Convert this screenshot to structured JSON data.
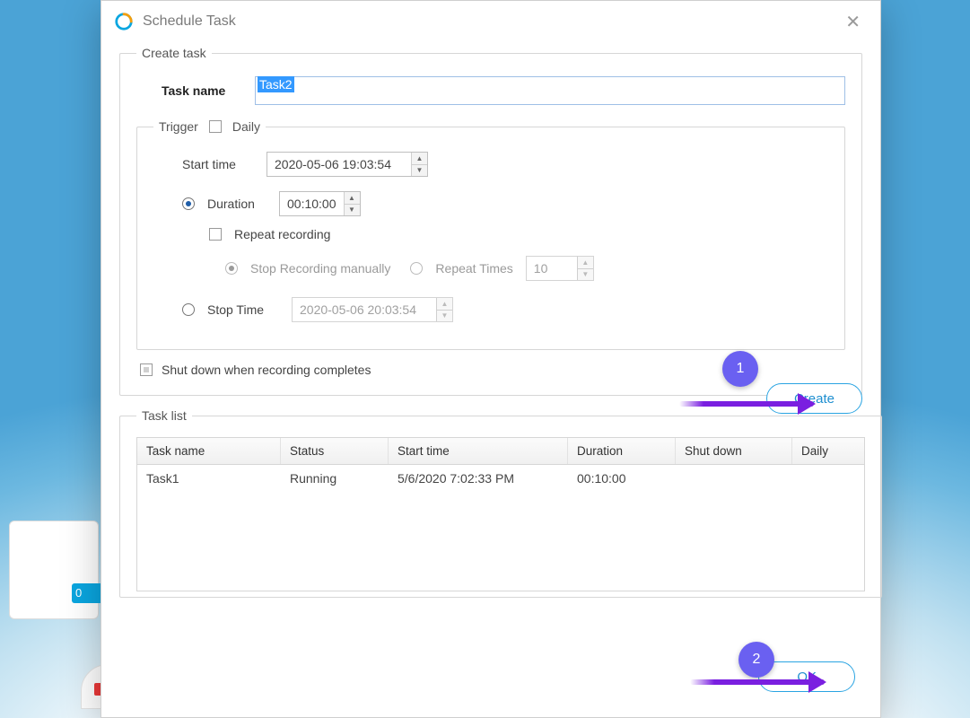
{
  "window": {
    "title": "Schedule Task"
  },
  "createTask": {
    "legend": "Create task",
    "taskNameLabel": "Task name",
    "taskNameValue": "Task2",
    "trigger": {
      "legend": "Trigger",
      "dailyLabel": "Daily",
      "dailyChecked": false,
      "startTimeLabel": "Start time",
      "startTimeValue": "2020-05-06 19:03:54",
      "durationLabel": "Duration",
      "durationValue": "00:10:00",
      "durationSelected": true,
      "repeatRecordingLabel": "Repeat recording",
      "repeatRecordingChecked": false,
      "stopManuallyLabel": "Stop Recording manually",
      "stopManuallySelected": true,
      "repeatTimesLabel": "Repeat Times",
      "repeatTimesSelected": false,
      "repeatTimesValue": "10",
      "stopTimeLabel": "Stop Time",
      "stopTimeSelected": false,
      "stopTimeValue": "2020-05-06 20:03:54"
    },
    "shutdownLabel": "Shut down when recording completes",
    "shutdownChecked": false,
    "createBtn": "Create"
  },
  "taskList": {
    "legend": "Task list",
    "headers": {
      "name": "Task name",
      "status": "Status",
      "start": "Start time",
      "duration": "Duration",
      "shutdown": "Shut down",
      "daily": "Daily"
    },
    "rows": [
      {
        "name": "Task1",
        "status": "Running",
        "start": "5/6/2020 7:02:33 PM",
        "duration": "00:10:00",
        "shutdown": "",
        "daily": ""
      }
    ]
  },
  "okBtn": "OK",
  "annotations": {
    "one": "1",
    "two": "2"
  },
  "bg": {
    "badge": "0"
  }
}
